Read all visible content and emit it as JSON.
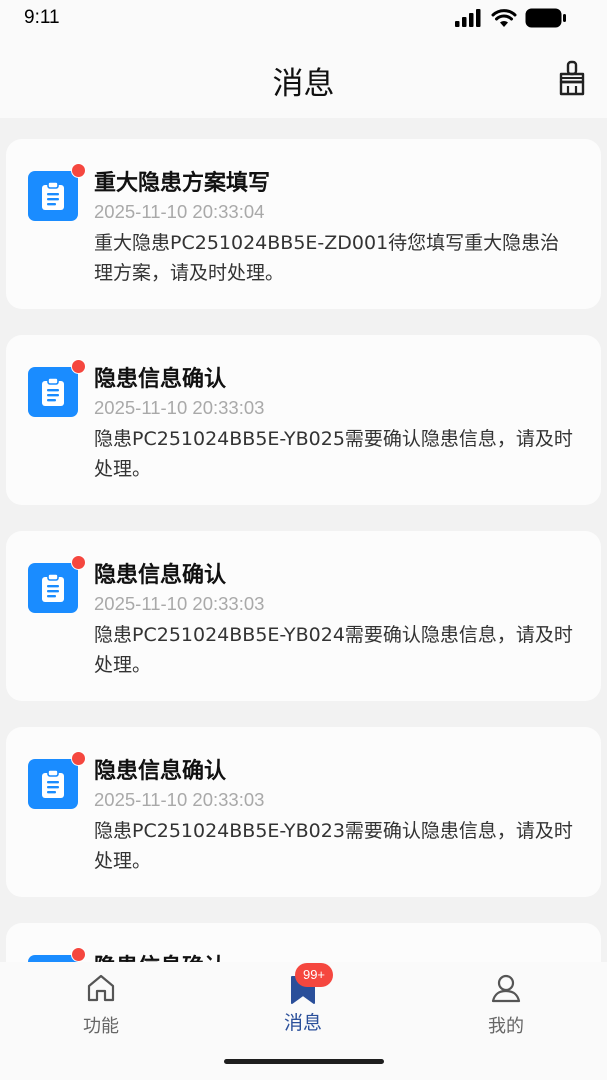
{
  "status_bar": {
    "time": "9:11"
  },
  "header": {
    "title": "消息",
    "clean_icon": "broom-icon"
  },
  "messages": [
    {
      "title": "重大隐患方案填写",
      "time": "2025-11-10 20:33:04",
      "body": "重大隐患PC251024BB5E-ZD001待您填写重大隐患治理方案，请及时处理。",
      "unread": true
    },
    {
      "title": "隐患信息确认",
      "time": "2025-11-10 20:33:03",
      "body": "隐患PC251024BB5E-YB025需要确认隐患信息，请及时处理。",
      "unread": true
    },
    {
      "title": "隐患信息确认",
      "time": "2025-11-10 20:33:03",
      "body": "隐患PC251024BB5E-YB024需要确认隐患信息，请及时处理。",
      "unread": true
    },
    {
      "title": "隐患信息确认",
      "time": "2025-11-10 20:33:03",
      "body": "隐患PC251024BB5E-YB023需要确认隐患信息，请及时处理。",
      "unread": true
    },
    {
      "title": "隐患信息确认",
      "time": "",
      "body": "",
      "unread": true
    }
  ],
  "tabs": [
    {
      "label": "功能",
      "icon": "home-icon",
      "active": false
    },
    {
      "label": "消息",
      "icon": "bookmark-icon",
      "active": true,
      "badge": "99+"
    },
    {
      "label": "我的",
      "icon": "user-icon",
      "active": false
    }
  ],
  "colors": {
    "accent": "#1a8cff",
    "badge": "#f5473f",
    "active_tab": "#2a4f9a"
  }
}
